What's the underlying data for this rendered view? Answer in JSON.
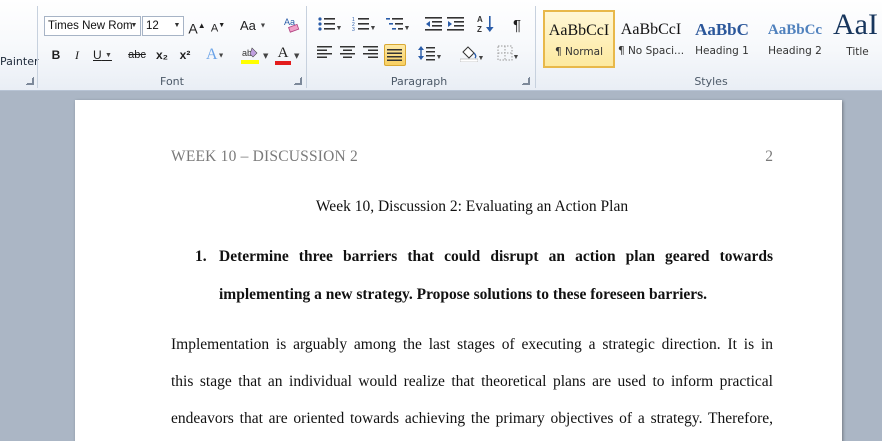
{
  "ribbon": {
    "clipboard": {
      "painter_label": "Painter"
    },
    "font": {
      "group_label": "Font",
      "font_name": "Times New Rom",
      "font_size": "12",
      "grow": "A",
      "shrink": "A",
      "change_case": "Aa",
      "bold": "B",
      "italic": "I",
      "underline": "U",
      "strikethrough": "abc",
      "subscript": "x₂",
      "superscript": "x²",
      "text_effects": "A",
      "font_color": "A"
    },
    "paragraph": {
      "group_label": "Paragraph",
      "pilcrow": "¶"
    },
    "styles": {
      "group_label": "Styles",
      "items": [
        {
          "sample": "AaBbCcI",
          "name": "¶ Normal",
          "color": "#111111"
        },
        {
          "sample": "AaBbCcI",
          "name": "¶ No Spaci...",
          "color": "#111111"
        },
        {
          "sample": "AaBbC",
          "name": "Heading 1",
          "color": "#2b579a"
        },
        {
          "sample": "AaBbCc",
          "name": "Heading 2",
          "color": "#4f81bd"
        },
        {
          "sample": "AaI",
          "name": "Title",
          "color": "#17365d"
        }
      ]
    }
  },
  "document": {
    "header_title": "WEEK 10 – DISCUSSION 2",
    "header_page": "2",
    "title": "Week 10, Discussion 2: Evaluating an Action Plan",
    "question_number": "1.",
    "question_lines": [
      "Determine three barriers that could disrupt an action plan geared towards",
      "implementing a new strategy. Propose solutions to these foreseen barriers."
    ],
    "body_lines": [
      "Implementation is arguably among the last stages of executing a strategic direction. It is in",
      "this stage that an individual would realize that theoretical plans are used to inform practical",
      "endeavors that are oriented towards achieving the primary objectives of a strategy. Therefore,"
    ]
  },
  "colors": {
    "highlight": "#ffff00",
    "font_color_bar": "#e31c1c",
    "ribbon_bg": "#f3f6fa",
    "doc_bg": "#abb6c5"
  }
}
